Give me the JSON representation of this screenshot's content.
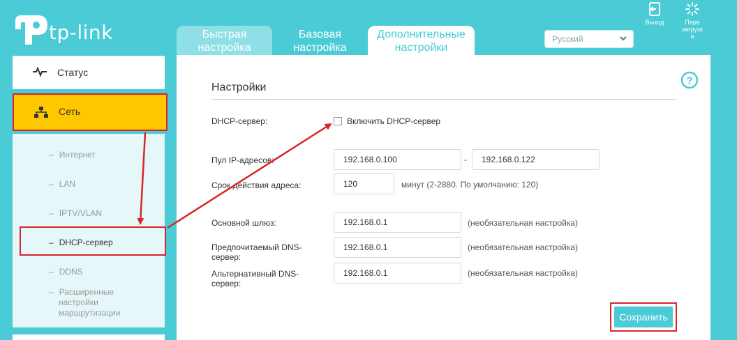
{
  "brand": {
    "logo_text": "tp-link"
  },
  "header": {
    "tabs": [
      {
        "label_line1": "Быстрая",
        "label_line2": "настройка"
      },
      {
        "label_line1": "Базовая",
        "label_line2": "настройка"
      },
      {
        "label_line1": "Дополнительные",
        "label_line2": "настройки"
      }
    ],
    "language": "Русский",
    "exit_label": "Выход",
    "reboot_label_1": "Пере",
    "reboot_label_2": "загрузк",
    "reboot_label_3": "а"
  },
  "sidebar": {
    "status_label": "Статус",
    "network_label": "Сеть",
    "sub_items": [
      {
        "label": "Интернет"
      },
      {
        "label": "LAN"
      },
      {
        "label": "IPTV/VLAN"
      },
      {
        "label": "DHCP-сервер"
      },
      {
        "label": "DDNS"
      },
      {
        "label_1": "Расширенные",
        "label_2": "настройки",
        "label_3": "маршрутизации"
      }
    ],
    "dash": "–"
  },
  "main": {
    "section_title": "Настройки",
    "dhcp_label": "DHCP-сервер:",
    "dhcp_checkbox_label": "Включить DHCP-сервер",
    "pool_label": "Пул IP-адресов:",
    "pool_start": "192.168.0.100",
    "pool_sep": "-",
    "pool_end": "192.168.0.122",
    "lease_label": "Срок действия адреса:",
    "lease_value": "120",
    "lease_note": "минут (2-2880. По умолчанию: 120)",
    "gateway_label": "Основной шлюз:",
    "gateway_value": "192.168.0.1",
    "dns1_label_1": "Предпочитаемый DNS-",
    "dns1_label_2": "сервер:",
    "dns1_value": "192.168.0.1",
    "dns2_label_1": "Альтернативный DNS-",
    "dns2_label_2": "сервер:",
    "dns2_value": "192.168.0.1",
    "optional_note": "(необязательная настройка)",
    "save_label": "Сохранить"
  },
  "colors": {
    "accent": "#4acbd6",
    "highlight_yellow": "#ffc700",
    "annotation_red": "#d7262b"
  }
}
